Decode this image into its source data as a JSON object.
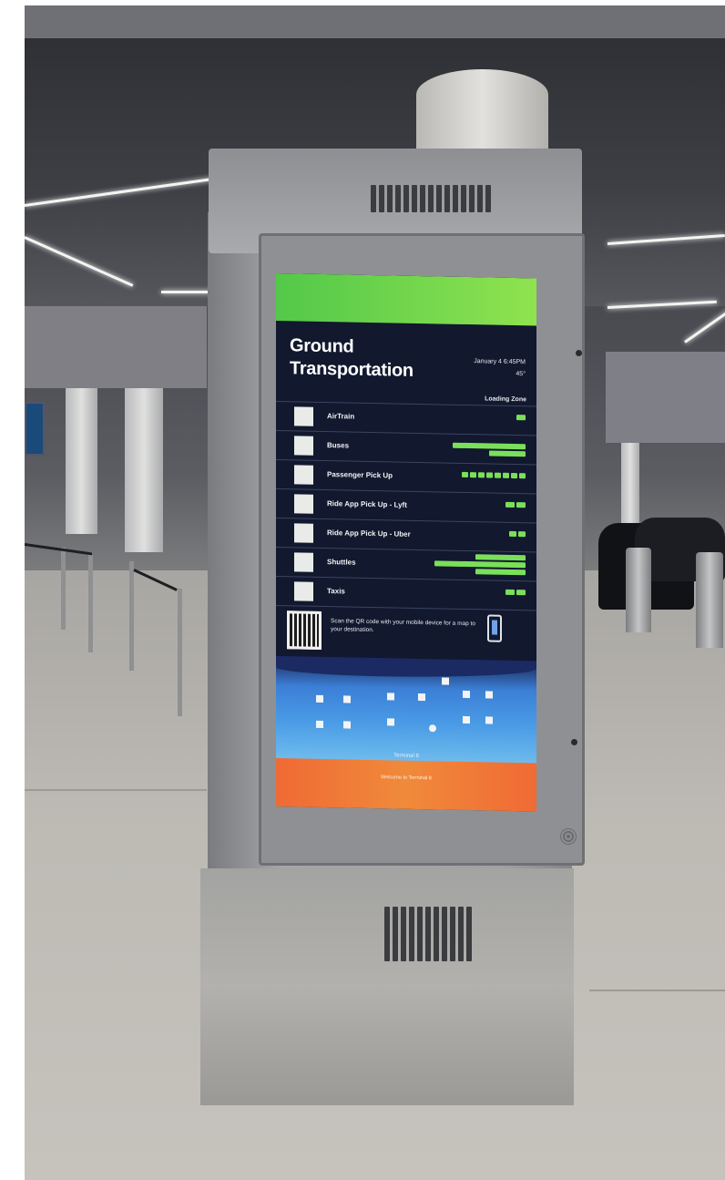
{
  "screen": {
    "title_line1": "Ground",
    "title_line2": "Transportation",
    "date": "January 4  6:45PM",
    "temperature": "45°",
    "column_header": "Loading Zone",
    "rows": [
      {
        "label": "AirTrain"
      },
      {
        "label": "Buses"
      },
      {
        "label": "Passenger Pick Up"
      },
      {
        "label": "Ride App Pick Up - Lyft"
      },
      {
        "label": "Ride App Pick Up - Uber"
      },
      {
        "label": "Shuttles"
      },
      {
        "label": "Taxis"
      }
    ],
    "qr_prompt": "Scan the QR code with your mobile device for a map to your destination.",
    "map_label": "Terminal 8",
    "footer": "Welcome to Terminal 8",
    "colors": {
      "header_bar": "#7ad64c",
      "footer_bar": "#f07a38",
      "indicator": "#7ae05a",
      "background": "#12182e"
    }
  }
}
